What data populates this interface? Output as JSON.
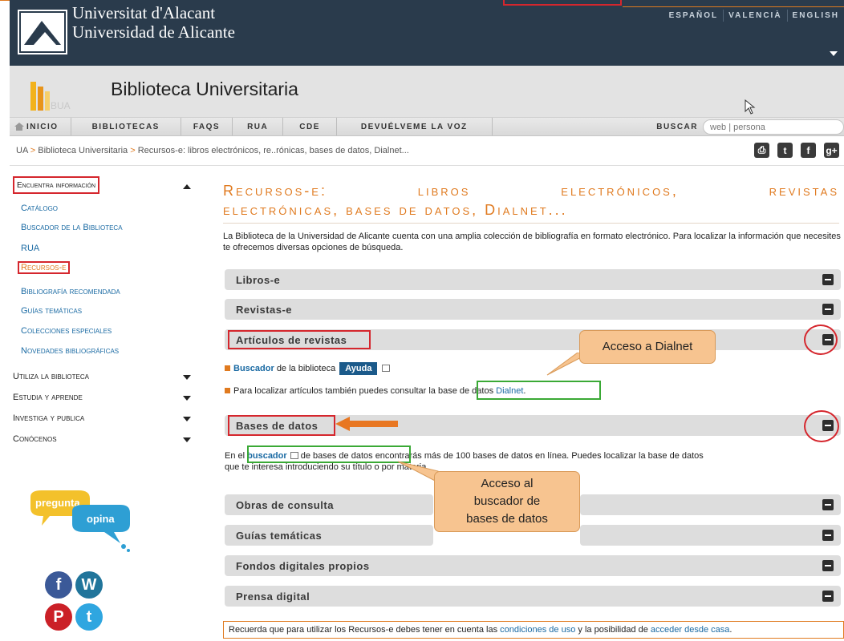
{
  "header": {
    "uni_line1": "Universitat d'Alacant",
    "uni_line2": "Universidad de Alicante",
    "languages": [
      "ESPAÑOL",
      "VALENCIÀ",
      "ENGLISH"
    ],
    "library_title": "Biblioteca Universitaria",
    "logo_text": "BUA"
  },
  "nav": {
    "items": [
      "INICIO",
      "BIBLIOTECAS",
      "FAQS",
      "RUA",
      "CDE",
      "DEVUÉLVEME LA VOZ"
    ],
    "search_label": "BUSCAR",
    "search_placeholder": "web | persona"
  },
  "breadcrumb": {
    "items": [
      "UA",
      "Biblioteca Universitaria",
      "Recursos-e: libros electrónicos, re..rónicas, bases de datos, Dialnet..."
    ],
    "separator": ">"
  },
  "sidebar": {
    "heading": "Encuentra información",
    "links": [
      "Catálogo",
      "Buscador de la Biblioteca",
      "RUA",
      "Recursos-e",
      "Bibliografía recomendada",
      "Guías temáticas",
      "Colecciones especiales",
      "Novedades bibliográficas"
    ],
    "sections": [
      "Utiliza la biblioteca",
      "Estudia y aprende",
      "Investiga y publica",
      "Conócenos"
    ],
    "bubble_top": "pregunta",
    "bubble_bottom": "opina"
  },
  "main": {
    "title_line1": "Recursos-e: libros electrónicos, revistas",
    "title_line2": "electrónicas, bases de datos, Dialnet...",
    "intro": "La Biblioteca de la Universidad de Alicante cuenta con una amplia colección de bibliografía en formato electrónico. Para localizar la información que necesites te ofrecemos diversas opciones de búsqueda.",
    "sections": {
      "libros": "Libros-e",
      "revistas": "Revistas-e",
      "articulos": "Artículos de revistas",
      "bases": "Bases de datos",
      "obras": "Obras de consulta",
      "guias": "Guías temáticas",
      "fondos": "Fondos digitales propios",
      "prensa": "Prensa digital"
    },
    "articulos_content": {
      "line1_link": "Buscador",
      "line1_text": "de la biblioteca",
      "ayuda": "Ayuda",
      "line2_text": "Para localizar artículos también puedes consultar la",
      "line2_highlight": "base de datos",
      "line2_link": "Dialnet",
      "line2_end": "."
    },
    "bases_content": {
      "pre": "En el",
      "link": "buscador",
      "mid": "de bases de datos",
      "post": "encontrarás más de 100 bases de datos en línea. Puedes localizar la base de datos",
      "line2": "que te interesa introduciendo su título o por materia."
    },
    "footer_pre": "Recuerda que para utilizar los Recursos-e debes tener en cuenta las",
    "footer_link1": "condiciones de uso",
    "footer_mid": "y la posibilidad de",
    "footer_link2": "acceder desde casa",
    "footer_end": "."
  },
  "annotations": {
    "callout_dialnet": "Acceso a Dialnet",
    "callout_buscador_1": "Acceso al",
    "callout_buscador_2": "buscador de",
    "callout_buscador_3": "bases de datos"
  },
  "colors": {
    "accent_orange": "#e07a1f",
    "link_blue": "#1a6aa3",
    "annotation_red": "#d5262d",
    "annotation_green": "#3aa935",
    "callout_fill": "#f7c490"
  },
  "icons": [
    "home-icon",
    "print-icon",
    "twitter-icon",
    "facebook-icon",
    "google-plus-icon",
    "external-link-icon",
    "collapse-icon",
    "wordpress-icon",
    "pinterest-icon"
  ]
}
